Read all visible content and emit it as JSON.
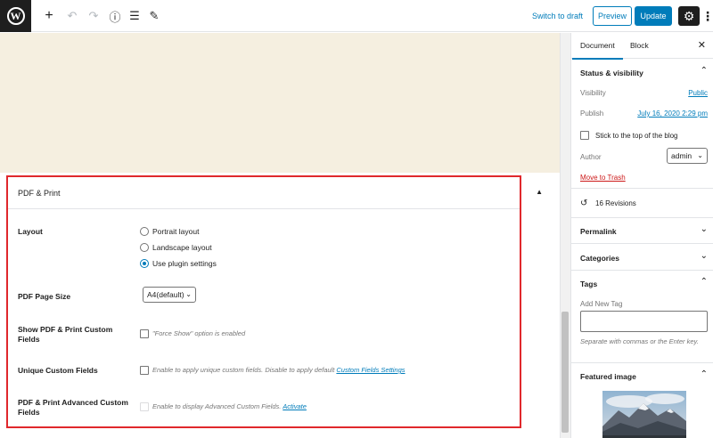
{
  "toolbar": {
    "logo_letter": "W",
    "add_icon": "+",
    "undo_icon": "↶",
    "redo_icon": "↷",
    "info_icon": "ⓘ",
    "outline_icon": "☰",
    "tools_icon": "✎",
    "switch_to_draft": "Switch to draft",
    "preview": "Preview",
    "update": "Update",
    "settings_icon": "⚙",
    "more_icon": "⋮"
  },
  "metabox": {
    "title": "PDF & Print",
    "toggle_icon": "▲",
    "layout": {
      "label": "Layout",
      "options": [
        "Portrait layout",
        "Landscape layout",
        "Use plugin settings"
      ],
      "selected_index": 2
    },
    "page_size": {
      "label": "PDF Page Size",
      "value": "A4(default)",
      "chevron": "⌄"
    },
    "show_custom": {
      "label": "Show PDF & Print Custom Fields",
      "help": "\"Force Show\" option is enabled"
    },
    "unique_custom": {
      "label": "Unique Custom Fields",
      "help": "Enable to apply unique custom fields. Disable to apply default ",
      "link": "Custom Fields Settings"
    },
    "advanced_custom": {
      "label": "PDF & Print Advanced Custom Fields",
      "help": "Enable to display Advanced Custom Fields. ",
      "link": "Activate"
    }
  },
  "sidebar": {
    "tab_document": "Document",
    "tab_block": "Block",
    "close_icon": "✕",
    "status": {
      "title": "Status & visibility",
      "chevron": "⌃",
      "visibility_label": "Visibility",
      "visibility_value": "Public",
      "publish_label": "Publish",
      "publish_value": "July 16, 2020 2:29 pm",
      "sticky_label": "Stick to the top of the blog",
      "author_label": "Author",
      "author_value": "admin",
      "author_chevron": "⌄",
      "trash": "Move to Trash"
    },
    "revisions": {
      "icon": "↺",
      "label": "16 Revisions"
    },
    "permalink": {
      "title": "Permalink",
      "chevron": "⌄"
    },
    "categories": {
      "title": "Categories",
      "chevron": "⌄"
    },
    "tags": {
      "title": "Tags",
      "chevron": "⌃",
      "add_label": "Add New Tag",
      "hint": "Separate with commas or the Enter key."
    },
    "featured": {
      "title": "Featured image",
      "chevron": "⌃"
    }
  },
  "colors": {
    "accent": "#007cba",
    "highlight_border": "#e0282c",
    "trash": "#cc1818",
    "canvas_bg": "#f5efe0"
  }
}
